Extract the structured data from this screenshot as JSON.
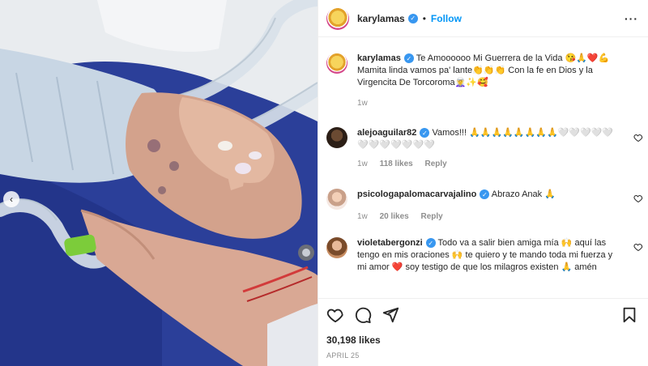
{
  "post": {
    "author": "karylamas",
    "follow_label": "Follow",
    "caption_author": "karylamas",
    "caption_text": "Te Amoooooo Mi Guerrera de la Vida 😘🙏❤️💪 Mamita linda vamos pa' lante👏👏👏 Con la fe en Dios y la Virgencita De Torcoroma🧝‍♀️✨🥰",
    "caption_time": "1w"
  },
  "comments": [
    {
      "user": "alejoaguilar82",
      "text": "Vamos!!! 🙏🙏🙏🙏🙏🙏🙏🙏🤍🤍🤍🤍🤍🤍🤍🤍🤍🤍🤍🤍",
      "time": "1w",
      "likes": "118 likes",
      "reply": "Reply"
    },
    {
      "user": "psicologapalomacarvajalino",
      "text": "Abrazo Anak 🙏",
      "time": "1w",
      "likes": "20 likes",
      "reply": "Reply"
    },
    {
      "user": "violetabergonzi",
      "text": "Todo va a salir bien amiga mía 🙌 aquí las tengo en mis oraciones 🙌 te quiero y te mando toda mi fuerza y mi amor ❤️ soy testigo de que los milagros existen 🙏 amén"
    }
  ],
  "footer": {
    "likes": "30,198 likes",
    "date": "APRIL 25"
  },
  "icons": {
    "like": "heart-icon",
    "comment": "comment-icon",
    "share": "share-icon",
    "save": "bookmark-icon",
    "more": "more-options-icon",
    "verified": "verified-badge-icon",
    "carousel_prev": "chevron-left-icon"
  },
  "colors": {
    "accent": "#0095f6",
    "verified": "#3897f0",
    "muted": "#8e8e8e"
  }
}
